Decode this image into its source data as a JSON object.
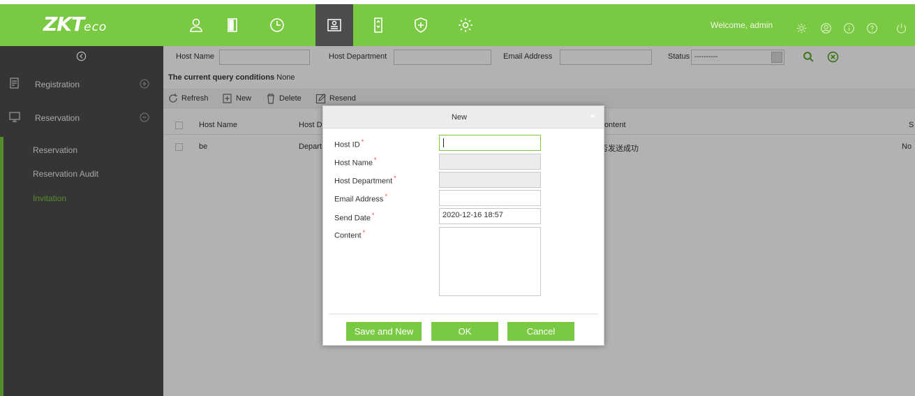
{
  "brand": {
    "logo_main": "ZKT",
    "logo_sub": "eco"
  },
  "header": {
    "welcome": "Welcome, admin",
    "nav_icons": [
      "person-icon",
      "door-icon",
      "clock-icon",
      "visitor-card-icon",
      "elevator-icon",
      "shield-plus-icon",
      "gear-icon"
    ],
    "utility_icons": [
      "settings-icon",
      "user-circle-icon",
      "info-icon",
      "help-icon",
      "power-icon"
    ]
  },
  "sidebar": {
    "sections": [
      {
        "label": "Registration",
        "icon": "registration-icon",
        "toggle": "expand-icon"
      },
      {
        "label": "Reservation",
        "icon": "monitor-icon",
        "toggle": "collapse-icon"
      }
    ],
    "sub_items": [
      {
        "label": "Reservation",
        "active": false
      },
      {
        "label": "Reservation Audit",
        "active": false
      },
      {
        "label": "Invitation",
        "active": true
      }
    ]
  },
  "filters": {
    "host_name_label": "Host Name",
    "host_department_label": "Host Department",
    "email_label": "Email Address",
    "status_label": "Status",
    "status_value": "----------"
  },
  "query": {
    "prefix": "The current query conditions",
    "value": "None"
  },
  "toolbar": {
    "refresh": "Refresh",
    "new": "New",
    "delete": "Delete",
    "resend": "Resend"
  },
  "table": {
    "headers": [
      "Host Name",
      "Host D",
      "Content",
      "S"
    ],
    "rows": [
      {
        "host_name": "be",
        "dept": "Depart",
        "content": "否发送成功",
        "status": "No"
      }
    ]
  },
  "dialog": {
    "title": "New",
    "close": "×",
    "fields": {
      "host_id": {
        "label": "Host ID",
        "value": ""
      },
      "host_name": {
        "label": "Host Name",
        "value": ""
      },
      "host_department": {
        "label": "Host Department",
        "value": ""
      },
      "email": {
        "label": "Email Address",
        "value": ""
      },
      "send_date": {
        "label": "Send Date",
        "value": "2020-12-16 18:57"
      },
      "content": {
        "label": "Content",
        "value": ""
      }
    },
    "required_mark": "*",
    "buttons": {
      "save_and_new": "Save and New",
      "ok": "OK",
      "cancel": "Cancel"
    }
  },
  "colors": {
    "accent": "#7ac943",
    "sidebar": "#4d4d4d",
    "required": "#ff4040"
  }
}
